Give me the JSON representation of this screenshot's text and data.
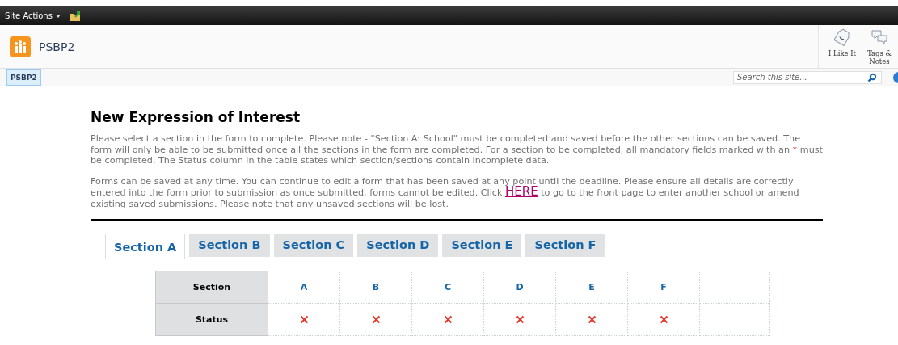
{
  "top_bar": {
    "site_actions": "Site Actions"
  },
  "header": {
    "site_title": "PSBP2",
    "actions": [
      {
        "kind": "like",
        "label": "I Like It"
      },
      {
        "kind": "tags",
        "label": "Tags & Notes"
      }
    ]
  },
  "nav": {
    "items": [
      {
        "label": "PSBP2",
        "selected": true
      }
    ],
    "search": {
      "placeholder": "Search this site..."
    }
  },
  "page": {
    "title": "New Expression of Interest",
    "paragraphs": [
      [
        {
          "kind": "text",
          "text": "Please select a section in the form to complete. Please note - \"Section A: School\" must be completed and saved before the other sections can be saved. The form will only be able to be submitted once all the sections in the form are completed. For a section to be completed, all mandatory fields marked with an "
        },
        {
          "kind": "required",
          "text": "*"
        },
        {
          "kind": "text",
          "text": " must be completed. The Status column in the table states which section/sections contain incomplete data."
        }
      ],
      [
        {
          "kind": "text",
          "text": "Forms can be saved at any time. You can continue to edit a form that has been saved at any point until the deadline. Please ensure all details are correctly entered into the form prior to submission as once submitted, forms cannot be edited. Click "
        },
        {
          "kind": "link",
          "text": "HERE"
        },
        {
          "kind": "text",
          "text": " to go to the front page to enter another school or amend existing saved submissions. Please note that any unsaved sections will be lost."
        }
      ]
    ],
    "tabs": [
      {
        "label": "Section A",
        "selected": true
      },
      {
        "label": "Section B",
        "selected": false
      },
      {
        "label": "Section C",
        "selected": false
      },
      {
        "label": "Section D",
        "selected": false
      },
      {
        "label": "Section E",
        "selected": false
      },
      {
        "label": "Section F",
        "selected": false
      }
    ],
    "status_table": {
      "row_headers": [
        "Section",
        "Status"
      ],
      "sections": [
        {
          "letter": "A",
          "complete": false
        },
        {
          "letter": "B",
          "complete": false
        },
        {
          "letter": "C",
          "complete": false
        },
        {
          "letter": "D",
          "complete": false
        },
        {
          "letter": "E",
          "complete": false
        },
        {
          "letter": "F",
          "complete": false
        }
      ]
    }
  }
}
